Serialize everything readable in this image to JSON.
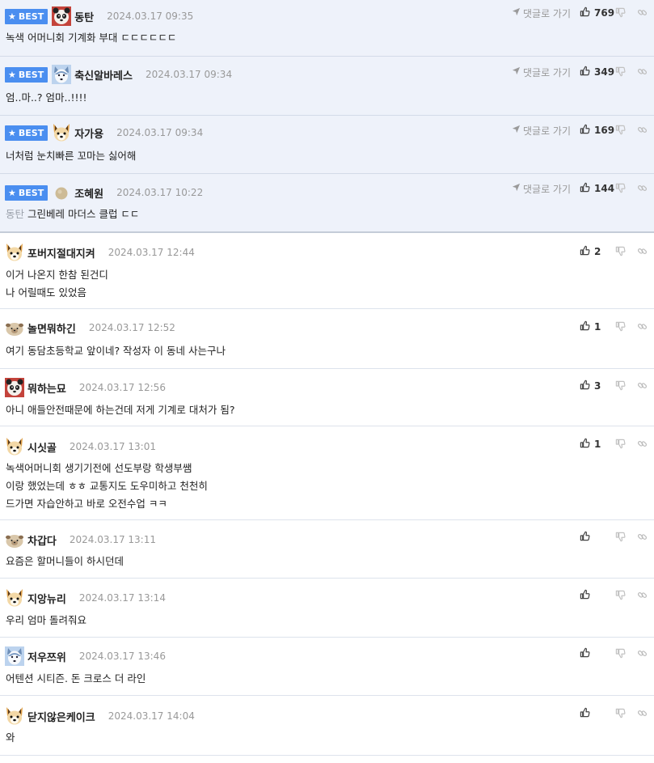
{
  "badge_label": "BEST",
  "goto_label": "댓글로 가기",
  "comments": [
    {
      "best": true,
      "avatar": "panda",
      "nick": "동탄",
      "date": "2024.03.17 09:35",
      "lines": [
        "녹색 어머니회 기계화 부대 ㄷㄷㄷㄷㄷㄷ"
      ],
      "mention": "",
      "likes": "769"
    },
    {
      "best": true,
      "avatar": "husky",
      "nick": "축신알바레스",
      "date": "2024.03.17 09:34",
      "lines": [
        "엄..마..? 엄마..!!!!"
      ],
      "mention": "",
      "likes": "349"
    },
    {
      "best": true,
      "avatar": "fox",
      "nick": "자가용",
      "date": "2024.03.17 09:34",
      "lines": [
        "너처럼 눈치빠른 꼬마는 싫어해"
      ],
      "mention": "",
      "likes": "169"
    },
    {
      "best": true,
      "avatar": "stone",
      "nick": "조혜원",
      "date": "2024.03.17 10:22",
      "lines": [
        "그린베레 마더스 클럽 ㄷㄷ"
      ],
      "mention": "동탄",
      "likes": "144"
    },
    {
      "best": false,
      "avatar": "fox",
      "nick": "포버지절대지켜",
      "date": "2024.03.17 12:44",
      "lines": [
        "이거 나온지 한참 된건디",
        "나 어릴때도 있었음"
      ],
      "mention": "",
      "likes": "2"
    },
    {
      "best": false,
      "avatar": "pug",
      "nick": "놀면뭐하긴",
      "date": "2024.03.17 12:52",
      "lines": [
        "여기 동담초등학교 앞이네? 작성자 이 동네 사는구나"
      ],
      "mention": "",
      "likes": "1"
    },
    {
      "best": false,
      "avatar": "panda",
      "nick": "뭐하는묘",
      "date": "2024.03.17 12:56",
      "lines": [
        "아니 애들안전때문에 하는건데 저게 기계로 대처가 됨?"
      ],
      "mention": "",
      "likes": "3"
    },
    {
      "best": false,
      "avatar": "fox",
      "nick": "시싯골",
      "date": "2024.03.17 13:01",
      "lines": [
        "녹색어머니회 생기기전에 선도부랑 학생부쌤",
        "이랑 했었는데 ㅎㅎ 교통지도 도우미하고 천천히",
        "드가면 자습안하고 바로 오전수업 ㅋㅋ"
      ],
      "mention": "",
      "likes": "1"
    },
    {
      "best": false,
      "avatar": "pug",
      "nick": "차갑다",
      "date": "2024.03.17 13:11",
      "lines": [
        "요즘은 할머니들이 하시던데"
      ],
      "mention": "",
      "likes": ""
    },
    {
      "best": false,
      "avatar": "fox",
      "nick": "지앙뉴리",
      "date": "2024.03.17 13:14",
      "lines": [
        "우리 엄마 돌려줘요"
      ],
      "mention": "",
      "likes": ""
    },
    {
      "best": false,
      "avatar": "husky",
      "nick": "저우쯔위",
      "date": "2024.03.17 13:46",
      "lines": [
        "어텐션 시티즌. 돈 크로스 더 라인"
      ],
      "mention": "",
      "likes": ""
    },
    {
      "best": false,
      "avatar": "fox",
      "nick": "닫지않은케이크",
      "date": "2024.03.17 14:04",
      "lines": [
        "와"
      ],
      "mention": "",
      "likes": ""
    }
  ]
}
